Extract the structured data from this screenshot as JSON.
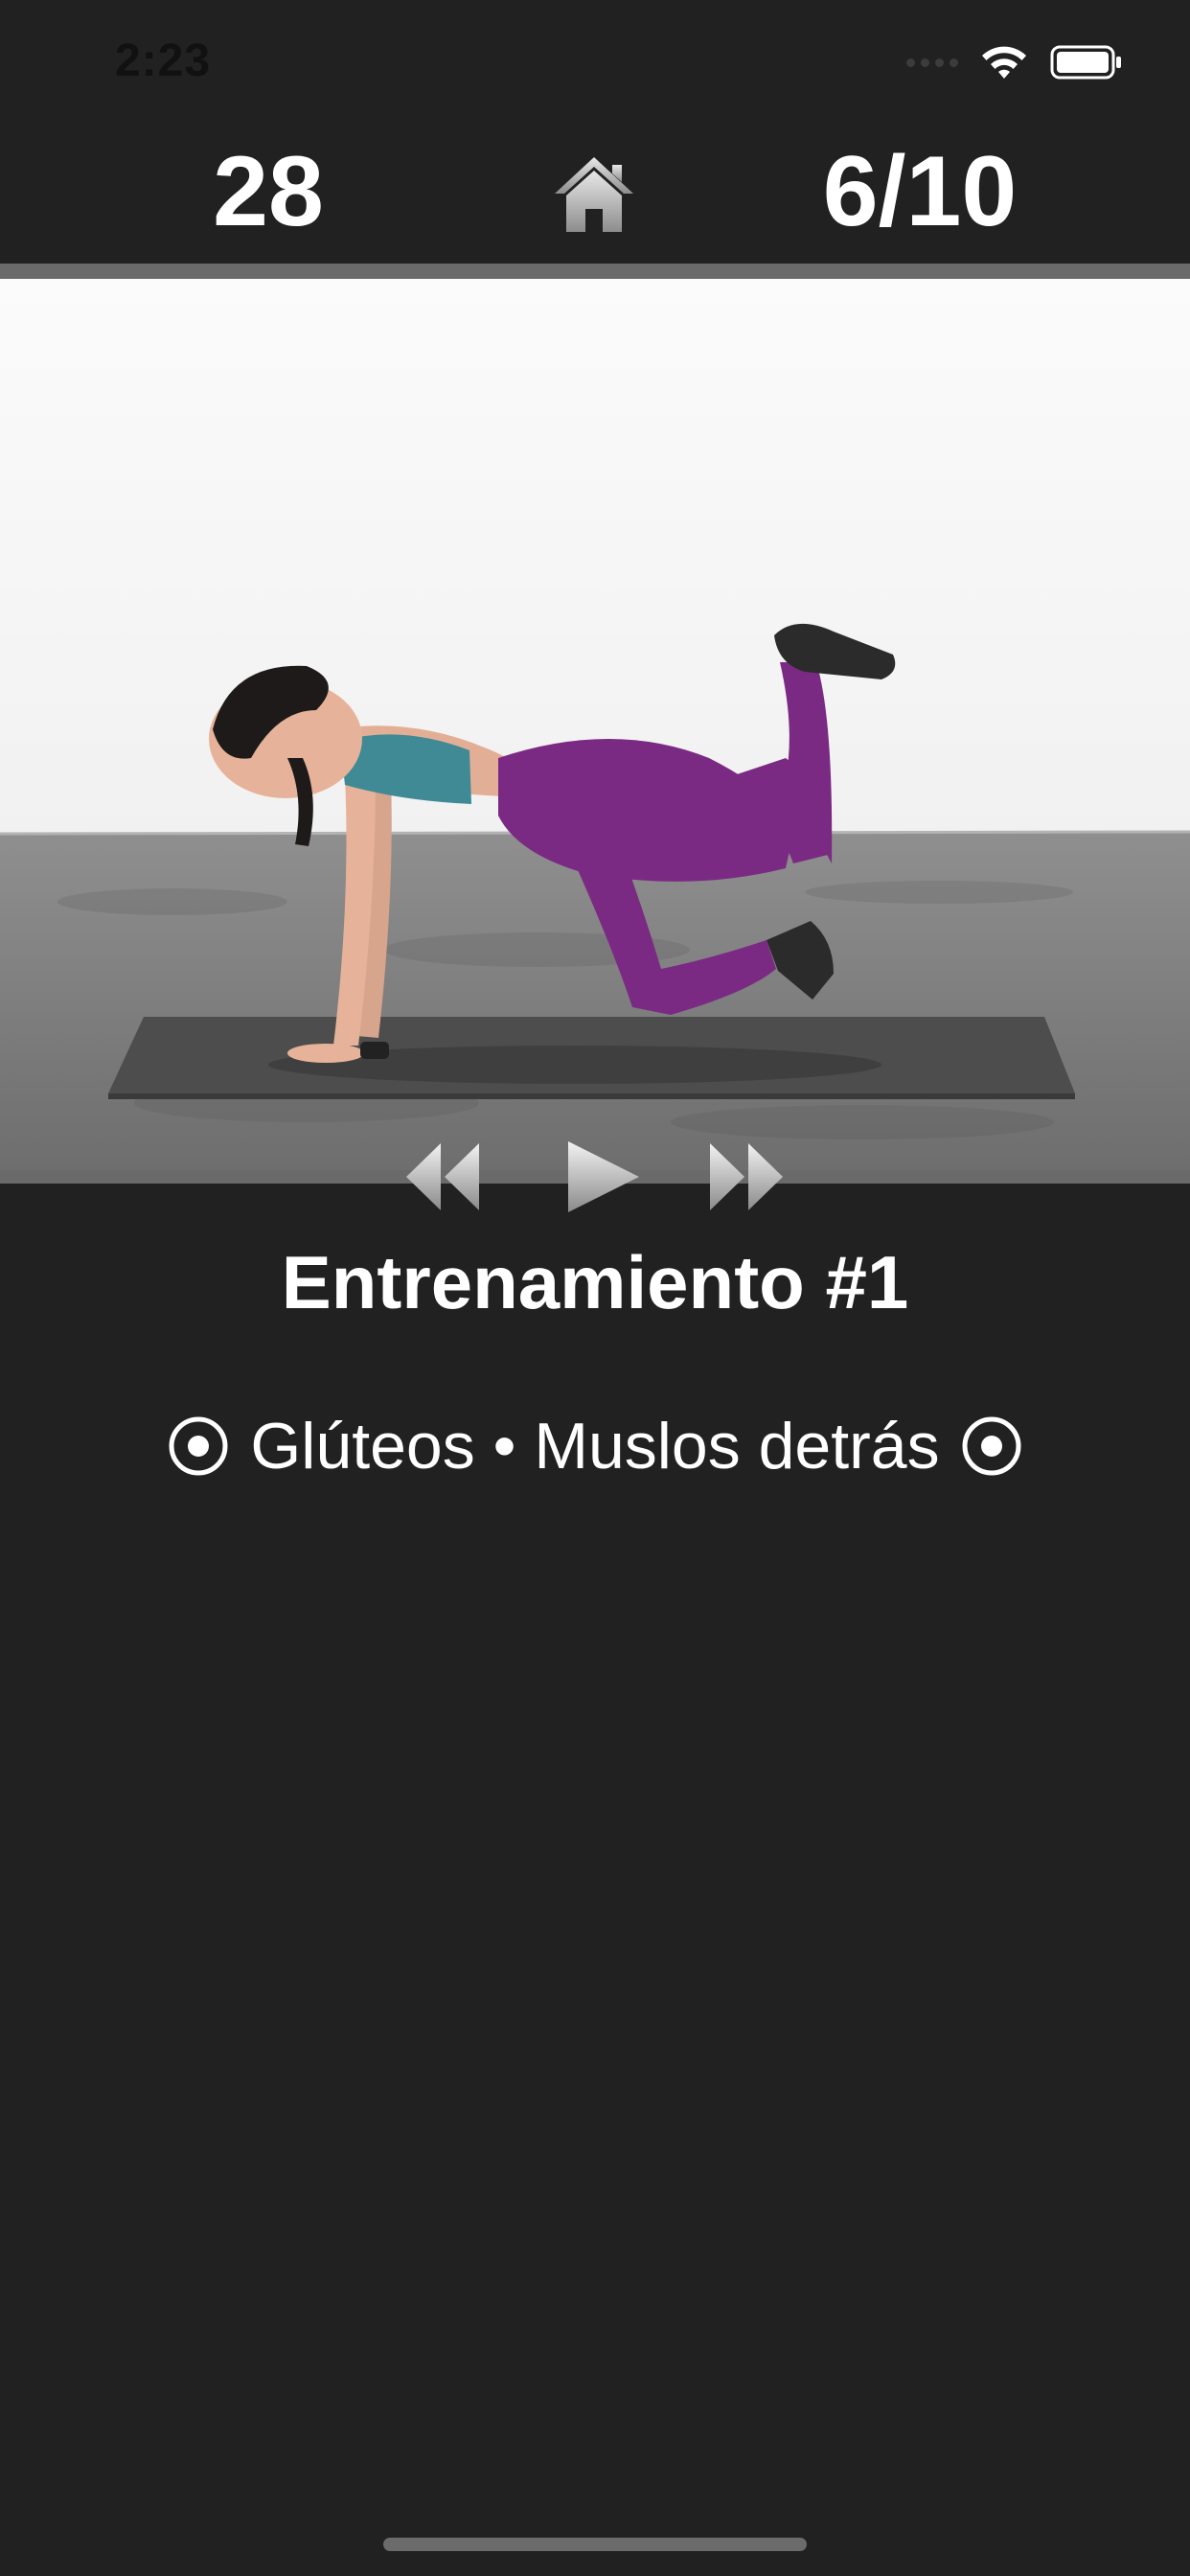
{
  "status_bar": {
    "time": "2:23"
  },
  "header": {
    "counter_left": "28",
    "progress": "6/10",
    "home_icon": "home-icon"
  },
  "exercise": {
    "title": "Entrenamiento #1",
    "targets": "Glúteos • Muslos detrás"
  },
  "controls": {
    "rewind_icon": "rewind-icon",
    "play_icon": "play-icon",
    "fast_forward_icon": "fast-forward-icon"
  },
  "colors": {
    "background": "#212121",
    "divider": "#6a6a6a",
    "text": "#ffffff"
  }
}
